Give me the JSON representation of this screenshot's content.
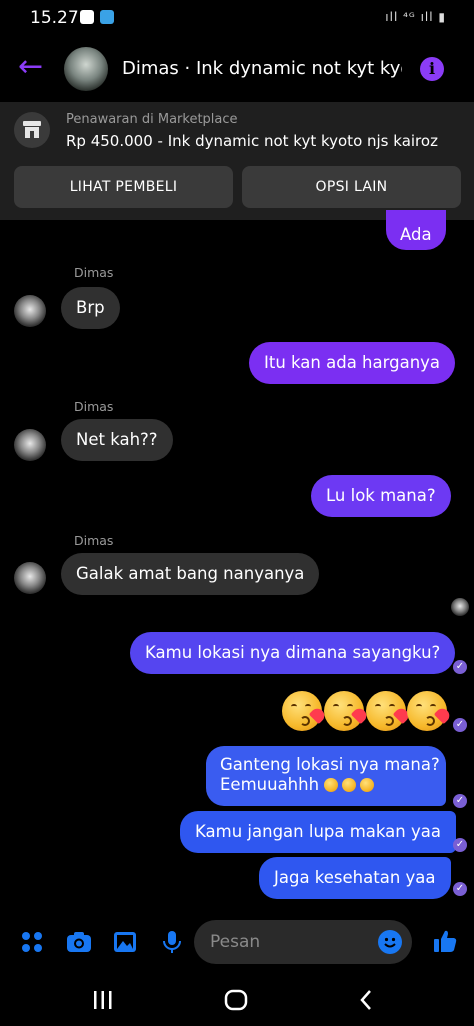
{
  "status_bar": {
    "time": "15.27",
    "right_icons": "ıll ⁴ᴳ ıll ▮"
  },
  "header": {
    "contact_title": "Dimas · Ink dynamic not kyt kyoto...",
    "accent": "#8b3cf7"
  },
  "marketplace": {
    "label": "Penawaran di Marketplace",
    "item": "Rp 450.000 - Ink dynamic not kyt kyoto njs kairoz",
    "buttons": [
      "LIHAT PEMBELI",
      "OPSI LAIN"
    ]
  },
  "messages": {
    "out1": "Ada",
    "sender": "Dimas",
    "in1": "Brp",
    "out2": "Itu kan ada harganya",
    "in2": "Net kah??",
    "out3": "Lu lok mana?",
    "in3": "Galak amat bang nanyanya",
    "out4": "Kamu lokasi nya dimana sayangku?",
    "out6_line1": "Ganteng lokasi nya mana?",
    "out6_line2": "Eemuuahhh",
    "out7": "Kamu jangan lupa makan yaa",
    "out8": "Jaga kesehatan yaa"
  },
  "colors": {
    "purple_bubble": "#7b2ff2",
    "blue_bubble": "#2f57f0",
    "incoming_bubble": "#303030",
    "messenger_blue": "#1877f2"
  },
  "composer": {
    "placeholder": "Pesan"
  },
  "icons": [
    "menu-dots-icon",
    "camera-icon",
    "image-icon",
    "microphone-icon",
    "emoji-icon",
    "thumbs-up-icon"
  ]
}
